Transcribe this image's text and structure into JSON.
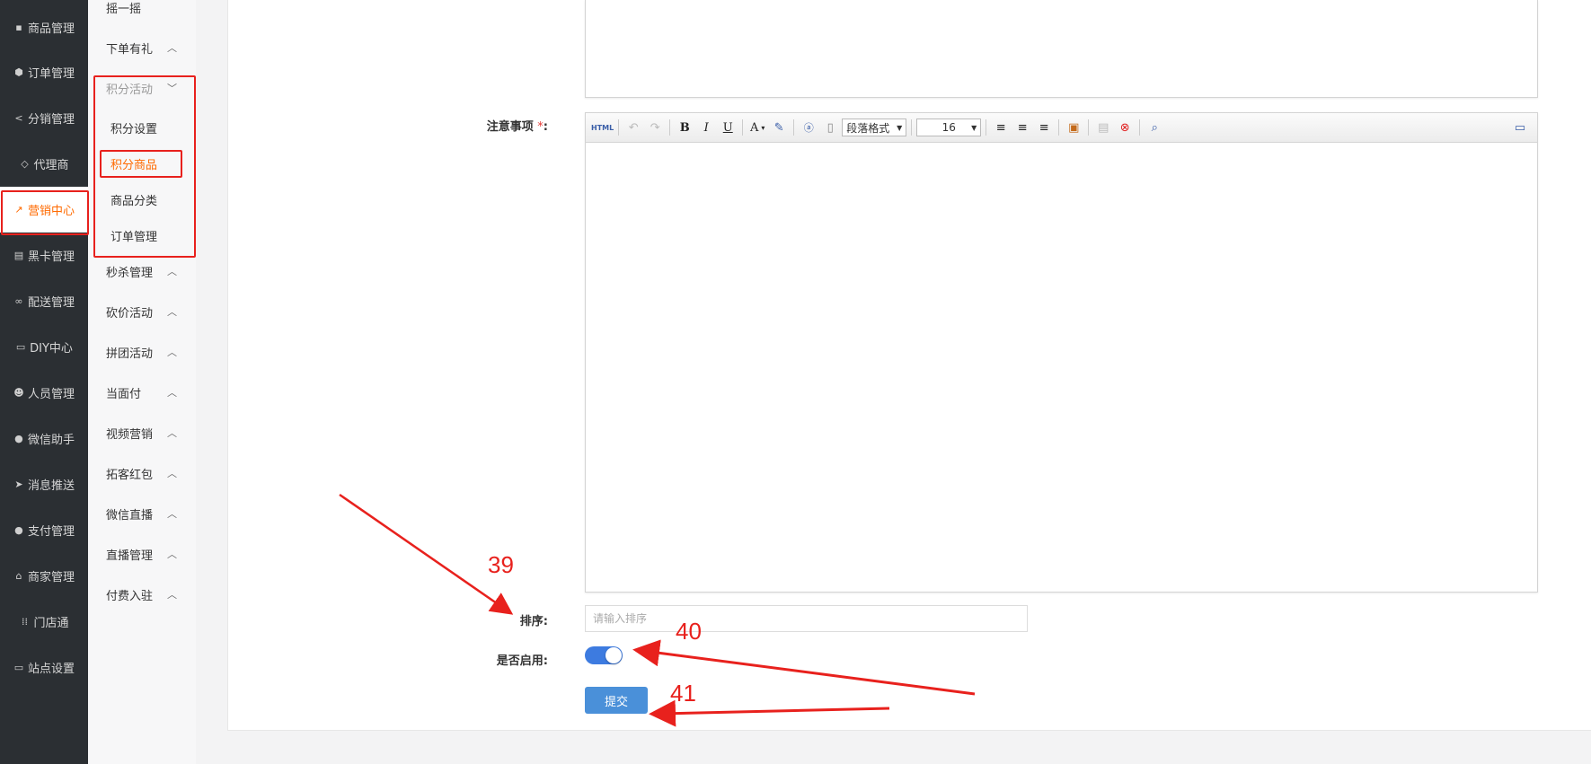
{
  "sidebar": {
    "items": [
      {
        "label": "商品管理",
        "icon": "bag-icon"
      },
      {
        "label": "订单管理",
        "icon": "cube-icon"
      },
      {
        "label": "分销管理",
        "icon": "share-icon"
      },
      {
        "label": "代理商",
        "icon": "diamond-icon"
      },
      {
        "label": "营销中心",
        "icon": "chart-icon",
        "active": true
      },
      {
        "label": "黑卡管理",
        "icon": "card-icon"
      },
      {
        "label": "配送管理",
        "icon": "bike-icon"
      },
      {
        "label": "DIY中心",
        "icon": "monitor-icon"
      },
      {
        "label": "人员管理",
        "icon": "users-icon"
      },
      {
        "label": "微信助手",
        "icon": "wechat-icon"
      },
      {
        "label": "消息推送",
        "icon": "send-icon"
      },
      {
        "label": "支付管理",
        "icon": "wechat-pay-icon"
      },
      {
        "label": "商家管理",
        "icon": "bank-icon"
      },
      {
        "label": "门店通",
        "icon": "grid-icon"
      },
      {
        "label": "站点设置",
        "icon": "desktop-icon"
      }
    ]
  },
  "subnav": {
    "top_item": "摇一摇",
    "items": [
      {
        "label": "下单有礼",
        "caret": "^"
      },
      {
        "label": "积分活动",
        "caret": "v",
        "expanded": true
      },
      {
        "label": "积分设置",
        "child": true
      },
      {
        "label": "积分商品",
        "child": true,
        "active": true
      },
      {
        "label": "商品分类",
        "child": true
      },
      {
        "label": "订单管理",
        "child": true
      },
      {
        "label": "秒杀管理",
        "caret": "^"
      },
      {
        "label": "砍价活动",
        "caret": "^"
      },
      {
        "label": "拼团活动",
        "caret": "^"
      },
      {
        "label": "当面付",
        "caret": "^"
      },
      {
        "label": "视频营销",
        "caret": "^"
      },
      {
        "label": "拓客红包",
        "caret": "^"
      },
      {
        "label": "微信直播",
        "caret": "^"
      },
      {
        "label": "直播管理",
        "caret": "^"
      },
      {
        "label": "付费入驻",
        "caret": "^"
      }
    ]
  },
  "form": {
    "notes_label": "注意事项",
    "required_mark": "*",
    "colon": ":",
    "sort_label": "排序:",
    "sort_placeholder": "请输入排序",
    "sort_value": "",
    "enable_label": "是否启用:",
    "enabled": true,
    "submit_label": "提交"
  },
  "editor": {
    "toolbar": {
      "html": "HTML",
      "undo": "↶",
      "redo": "↷",
      "bold": "B",
      "italic": "I",
      "underline": "U",
      "font_color": "A",
      "paragraph_format": "段落格式",
      "font_size": "16"
    }
  },
  "annotations": {
    "num_39": "39",
    "num_40": "40",
    "num_41": "41",
    "color": "#e8211d"
  }
}
